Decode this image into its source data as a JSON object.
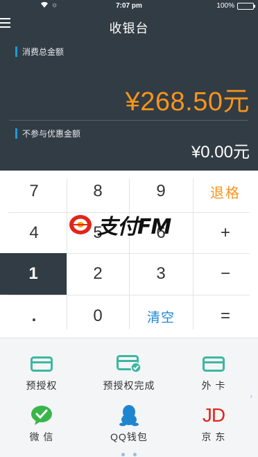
{
  "status_bar": {
    "time": "7:07 pm",
    "battery": "100%"
  },
  "header": {
    "title": "收银台",
    "total_label": "消费总金额",
    "total_amount": "¥268.50元",
    "discount_label": "不参与优惠金额",
    "discount_amount": "¥0.00元"
  },
  "keypad": {
    "keys": [
      "7",
      "8",
      "9",
      "退格",
      "4",
      "5",
      "6",
      "+",
      "1",
      "2",
      "3",
      "−",
      ".",
      "0",
      "清空",
      "="
    ]
  },
  "watermark": {
    "text": "支付FM"
  },
  "payment_options": [
    {
      "label": "预授权",
      "icon": "card-icon"
    },
    {
      "label": "预授权完成",
      "icon": "card-check-icon"
    },
    {
      "label": "外 卡",
      "icon": "card-icon"
    },
    {
      "label": "微 信",
      "icon": "wechat-icon"
    },
    {
      "label": "QQ钱包",
      "icon": "qq-icon"
    },
    {
      "label": "京 东",
      "icon": "jd-logo",
      "logo_text": "JD"
    }
  ],
  "colors": {
    "header_bg": "#323c44",
    "accent_orange": "#f7941d",
    "accent_blue": "#1e9bd7",
    "card_green": "#3bb8a0",
    "jd_red": "#e1251b"
  }
}
